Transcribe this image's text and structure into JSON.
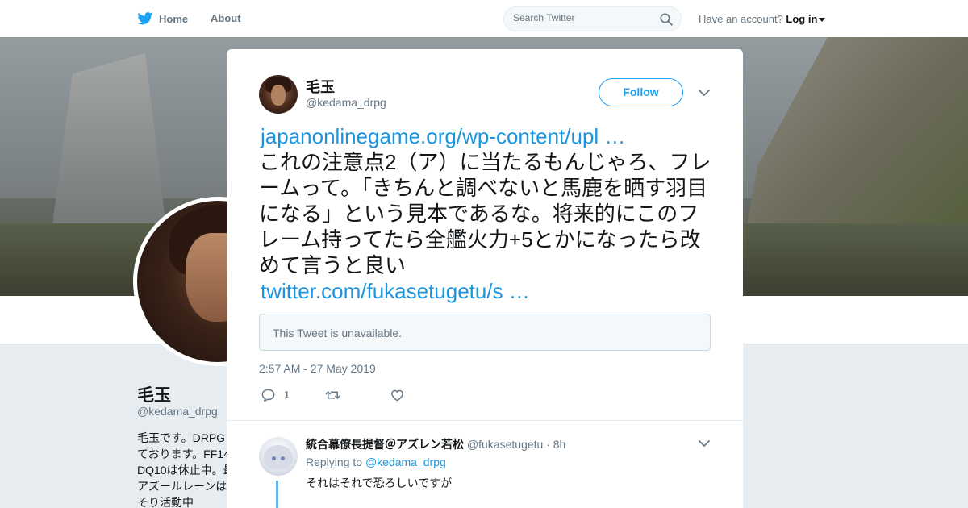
{
  "topnav": {
    "home_label": "Home",
    "about_label": "About",
    "search_placeholder": "Search Twitter",
    "account_prompt": "Have an account?",
    "login_label": "Log in"
  },
  "profile": {
    "name": "毛玉",
    "handle": "@kedama_drpg",
    "bio_lines": [
      "毛玉です。DRPG",
      "ております。FF14",
      "DQ10は休止中。最",
      "アズールレーンは",
      "そり活動中"
    ]
  },
  "tweet": {
    "author_name": "毛玉",
    "author_handle": "@kedama_drpg",
    "follow_label": "Follow",
    "link1": "japanonlinegame.org/wp-content/upl …",
    "body": "これの注意点2（ア）に当たるもんじゃろ、フレームって。「きちんと調べないと馬鹿を晒す羽目になる」という見本であるな。将来的にこのフレーム持ってたら全艦火力+5とかになったら改めて言うと良い",
    "link2": "twitter.com/fukasetugetu/s …",
    "quote_unavailable": "This Tweet is unavailable.",
    "timestamp": "2:57 AM - 27 May 2019",
    "reply_count": "1"
  },
  "reply": {
    "name": "統合幕僚長提督＠アズレン若松",
    "handle": "@fukasetugetu",
    "time": "· 8h",
    "replying_prefix": "Replying to",
    "replying_handle": "@kedama_drpg",
    "text": "それはそれで恐ろしいですが"
  },
  "colors": {
    "accent": "#1da1f2",
    "link": "#1b95e0",
    "muted": "#657786",
    "background": "#e6ecf0"
  },
  "icons": [
    "twitter-bird-icon",
    "search-icon",
    "close-icon",
    "chevron-down-icon",
    "reply-icon",
    "retweet-icon",
    "heart-icon"
  ]
}
